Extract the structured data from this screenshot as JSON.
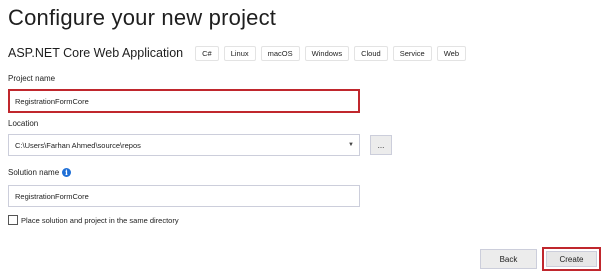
{
  "header": {
    "title": "Configure your new project"
  },
  "template": {
    "name": "ASP.NET Core Web Application",
    "tags": [
      "C#",
      "Linux",
      "macOS",
      "Windows",
      "Cloud",
      "Service",
      "Web"
    ]
  },
  "form": {
    "project_name": {
      "label": "Project name",
      "value": "RegistrationFormCore"
    },
    "location": {
      "label": "Location",
      "value": "C:\\Users\\Farhan Ahmed\\source\\repos",
      "browse_label": "..."
    },
    "solution_name": {
      "label": "Solution name",
      "value": "RegistrationFormCore",
      "info_glyph": "i"
    },
    "same_directory": {
      "label": "Place solution and project in the same directory",
      "checked": false
    }
  },
  "footer": {
    "back_label": "Back",
    "create_label": "Create"
  },
  "colors": {
    "highlight": "#c0272d",
    "info": "#1f6fd6"
  },
  "icons": {
    "dropdown": "chevron-down-icon",
    "info": "info-icon"
  }
}
